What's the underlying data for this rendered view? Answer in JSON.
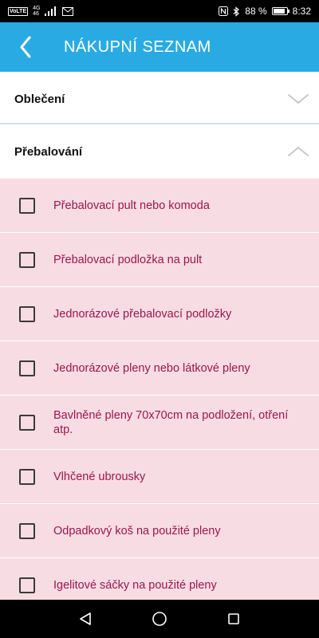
{
  "status_bar": {
    "carrier_chip": "VoLTE",
    "network_top": "4G",
    "network_bottom": "46",
    "battery_percent_text": "88 %",
    "battery_level": 0.88,
    "time": "8:32"
  },
  "app_bar": {
    "title": "NÁKUPNÍ SEZNAM"
  },
  "sections": [
    {
      "title": "Oblečení",
      "expanded": false
    },
    {
      "title": "Přebalování",
      "expanded": true
    }
  ],
  "items": [
    {
      "label": "Přebalovací pult nebo komoda",
      "checked": false
    },
    {
      "label": "Přebalovací podložka na pult",
      "checked": false
    },
    {
      "label": "Jednorázové přebalovací podložky",
      "checked": false
    },
    {
      "label": "Jednorázové pleny nebo látkové pleny",
      "checked": false
    },
    {
      "label": "Bavlněné pleny 70x70cm na podložení, otření atp.",
      "checked": false
    },
    {
      "label": "Vlhčené ubrousky",
      "checked": false
    },
    {
      "label": "Odpadkový koš na použité pleny",
      "checked": false
    },
    {
      "label": "Igelitové sáčky na použité pleny",
      "checked": false
    }
  ],
  "colors": {
    "app_bar": "#2aaae2",
    "list_background": "#f8dce3",
    "item_text": "#9a1650"
  }
}
